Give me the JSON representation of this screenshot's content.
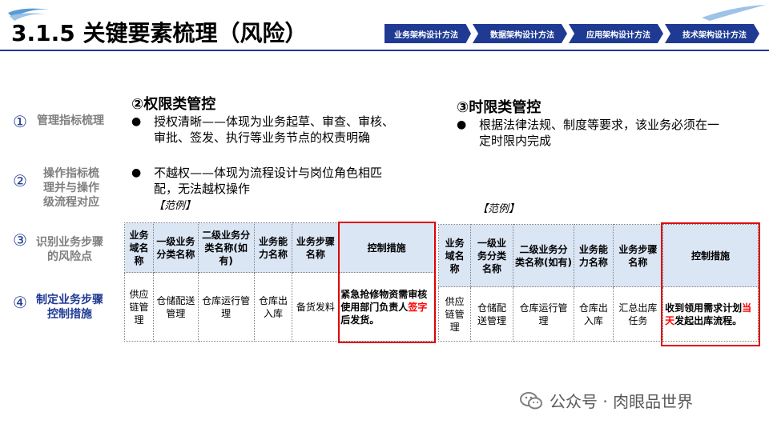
{
  "header": {
    "title": "3.1.5 关键要素梳理（风险）",
    "steps": [
      "业务架构设计方法",
      "数据架构设计方法",
      "应用架构设计方法",
      "技术架构设计方法"
    ]
  },
  "steplist": [
    {
      "num": "①",
      "text": "管理指标梳理"
    },
    {
      "num": "②",
      "text": "操作指标梳理并与操作级流程对应"
    },
    {
      "num": "③",
      "text": "识别业务步骤的风险点"
    },
    {
      "num": "④",
      "text": "制定业务步骤控制措施"
    }
  ],
  "section_left": {
    "title": "②权限类管控",
    "bullets": [
      "授权清晰——体现为业务起草、审查、审核、审批、签发、执行等业务节点的权责明确",
      "不越权——体现为流程设计与岗位角色相匹配，无法越权操作"
    ],
    "example": "【范例】"
  },
  "section_right": {
    "title": "③时限类管控",
    "bullets": [
      "根据法律法规、制度等要求，该业务必须在一定时限内完成"
    ],
    "example": "【范例】"
  },
  "table_left": {
    "headers": [
      "业务域名称",
      "一级业务分类名称",
      "二级业务分类名称(如有)",
      "业务能力名称",
      "业务步骤名称",
      "控制措施"
    ],
    "row": [
      "供应链管理",
      "仓储配送管理",
      "仓库运行管理",
      "仓库出入库",
      "备货发料"
    ],
    "ctrl_before": "紧急抢修物资需审核使用部门负责人",
    "ctrl_red": "签字",
    "ctrl_after": "后发货。"
  },
  "table_right": {
    "headers": [
      "业务域名称",
      "一级业务分类名称",
      "二级业务分类名称(如有)",
      "业务能力名称",
      "业务步骤名称",
      "控制措施"
    ],
    "row": [
      "供应链管理",
      "仓储配送管理",
      "仓库运行管理",
      "仓库出入库",
      "汇总出库任务"
    ],
    "ctrl_before": "收到领用需求计划",
    "ctrl_red": "当天",
    "ctrl_after": "发起出库流程。"
  },
  "watermark": "公众号 · 肉眼品世界",
  "colors": {
    "brand": "#1f3a93",
    "highlight": "#ff0000",
    "header_cell": "#dbe6f5"
  }
}
